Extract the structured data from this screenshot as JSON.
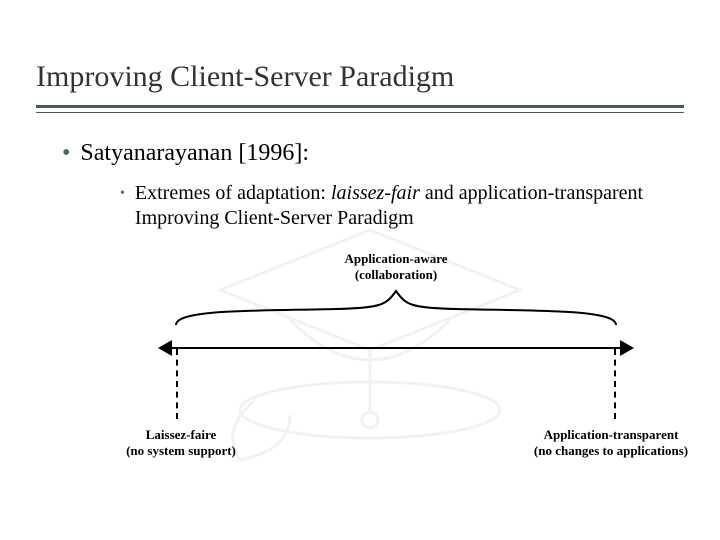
{
  "title": "Improving Client-Server Paradigm",
  "bullets": {
    "level1": "Satyanarayanan [1996]:",
    "level2_prefix": "Extremes of adaptation: ",
    "level2_italic": "laissez-fair",
    "level2_suffix": " and application-transparent Improving Client-Server Paradigm"
  },
  "diagram": {
    "top_label_line1": "Application-aware",
    "top_label_line2": "(collaboration)",
    "left_label_line1": "Laissez-faire",
    "left_label_line2": "(no system support)",
    "right_label_line1": "Application-transparent",
    "right_label_line2": "(no changes to applications)"
  }
}
